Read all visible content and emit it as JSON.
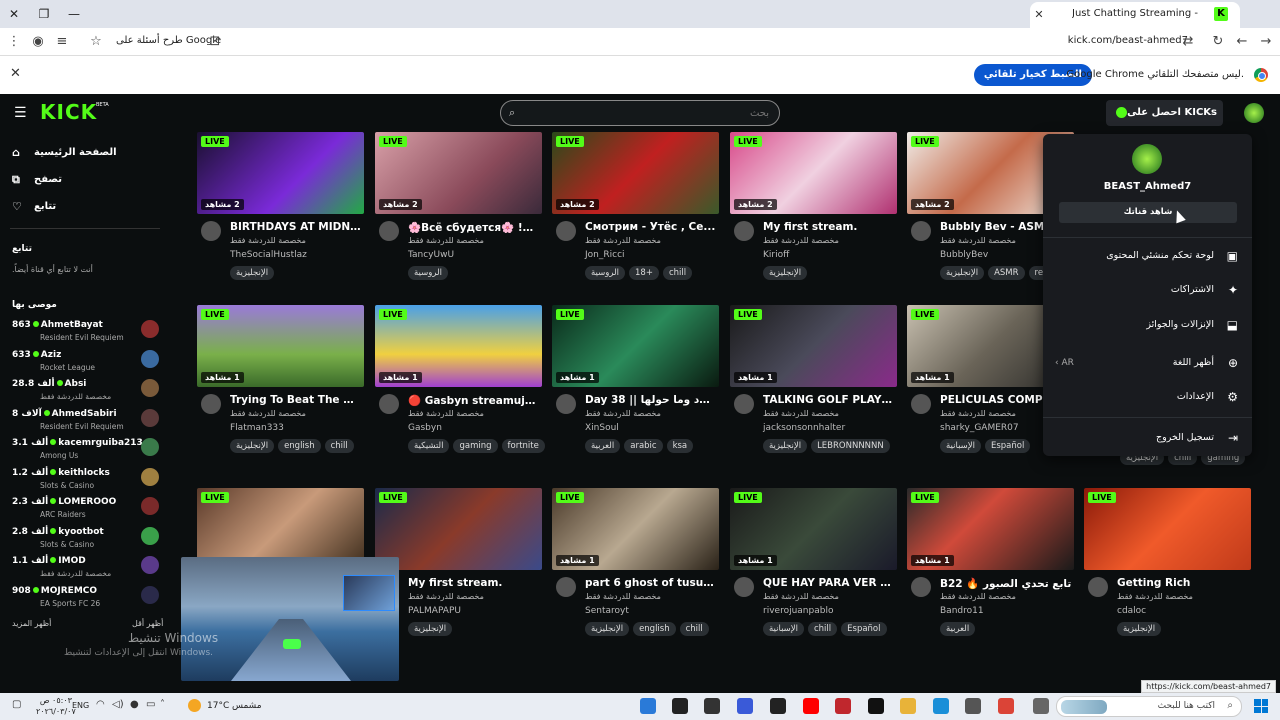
{
  "browser": {
    "tab_title": "Just Chatting Streaming - L",
    "tab_favicon": "K",
    "url": "kick.com/beast-ahmed7",
    "google_query": "طرح أسئلة على Google",
    "infobar_text": "Google Chrome ليس متصفحك التلقائي.",
    "infobar_button": "الضبط كخيار تلقائي",
    "status_url": "https://kick.com/beast-ahmed7"
  },
  "header": {
    "logo": "KICK",
    "beta": "BETA",
    "search_placeholder": "بحث",
    "get_kicks": "احصل على KICKs"
  },
  "sidebar": {
    "nav": [
      {
        "label": "الصفحة الرئيسية",
        "icon": "home-icon"
      },
      {
        "label": "تصفح",
        "icon": "browse-icon"
      },
      {
        "label": "تتابع",
        "icon": "heart-icon"
      }
    ],
    "following_heading": "تتابع",
    "following_empty": "أنت لا تتابع أي قناة أيضاً.",
    "recommended_heading": "موصى بها",
    "recommended": [
      {
        "name": "AhmetBayat",
        "viewers": "863",
        "game": "Resident Evil Requiem",
        "color": "#8a2c2c"
      },
      {
        "name": "Aziz",
        "viewers": "633",
        "game": "Rocket League",
        "color": "#3a6aa0"
      },
      {
        "name": "Absi",
        "viewers": "28.8 ألف",
        "game": "مخصصة للدردشة فقط",
        "color": "#7a5a3a"
      },
      {
        "name": "AhmedSabiri",
        "viewers": "8 آلاف",
        "game": "Resident Evil Requiem",
        "color": "#5a3a3a"
      },
      {
        "name": "kacemrguiba213",
        "viewers": "3.1 ألف",
        "game": "Among Us",
        "color": "#3a7a4a"
      },
      {
        "name": "keithlocks",
        "viewers": "1.2 ألف",
        "game": "Slots & Casino",
        "color": "#a08040"
      },
      {
        "name": "LOMEROOO",
        "viewers": "2.3 ألف",
        "game": "ARC Raiders",
        "color": "#7a2a2a"
      },
      {
        "name": "kyootbot",
        "viewers": "2.8 ألف",
        "game": "Slots & Casino",
        "color": "#3aa04a"
      },
      {
        "name": "IMOD",
        "viewers": "1.1 ألف",
        "game": "مخصصة للدردشة فقط",
        "color": "#5a3a8a"
      },
      {
        "name": "MOJREMCO",
        "viewers": "908",
        "game": "EA Sports FC 26",
        "color": "#2a2a4a"
      }
    ],
    "show_more": "أظهر المزيد",
    "show_less": "أظهر أقل"
  },
  "streams": [
    {
      "title": "BIRTHDAYS AT MIDNI...",
      "category": "مخصصة للدردشة فقط",
      "channel": "TheSocialHustlaz",
      "viewers": "2 مشاهد",
      "tags": [
        "الإنجليزية"
      ],
      "thumb": "linear-gradient(135deg,#1a1030,#7a2ad8 60%,#22aa44)"
    },
    {
      "title": "🌸Всё сбудется🌸 !b...",
      "category": "مخصصة للدردشة فقط",
      "channel": "TancyUwU",
      "viewers": "2 مشاهد",
      "tags": [
        "الروسية"
      ],
      "thumb": "linear-gradient(135deg,#d8a0a8,#8a4a5a 60%,#3a2a3a)"
    },
    {
      "title": "Смотрим - Утёс , Се...",
      "category": "مخصصة للدردشة فقط",
      "channel": "Jon_Ricci",
      "viewers": "2 مشاهد",
      "tags": [
        "الروسية",
        "18+",
        "chill"
      ],
      "thumb": "linear-gradient(135deg,#2a4a1a,#c02020 50%,#3a5a2a)"
    },
    {
      "title": "My first stream.",
      "category": "مخصصة للدردشة فقط",
      "channel": "Kirioff",
      "viewers": "2 مشاهد",
      "tags": [
        "الإنجليزية"
      ],
      "thumb": "linear-gradient(135deg,#d84a8a,#f0d0e0 50%,#b03070)"
    },
    {
      "title": "Bubbly Bev - ASMR",
      "category": "مخصصة للدردشة فقط",
      "channel": "BubblyBev",
      "viewers": "2 مشاهد",
      "tags": [
        "الإنجليزية",
        "ASMR",
        "rela"
      ],
      "thumb": "linear-gradient(135deg,#f0ece8,#c46a4a 50%,#f0e8e0)"
    },
    {
      "title": "Trying To Beat The Or...",
      "category": "مخصصة للدردشة فقط",
      "channel": "Flatman333",
      "viewers": "1 مشاهد",
      "tags": [
        "الإنجليزية",
        "english",
        "chill"
      ],
      "thumb": "linear-gradient(180deg,#9a7ad8,#7ab04a 60%,#3a6a2a)"
    },
    {
      "title": "🔴 Gasbyn streamuje ...",
      "category": "مخصصة للدردشة فقط",
      "channel": "Gasbyn",
      "viewers": "1 مشاهد",
      "tags": [
        "التشيكية",
        "gaming",
        "fortnite"
      ],
      "thumb": "linear-gradient(180deg,#4aa0e8,#f0d040 60%,#a040d0)"
    },
    {
      "title": "Day 38 || البلاد وما حولها ...",
      "category": "مخصصة للدردشة فقط",
      "channel": "XinSoul",
      "viewers": "1 مشاهد",
      "tags": [
        "العربية",
        "arabic",
        "ksa"
      ],
      "thumb": "linear-gradient(135deg,#0a2a1a,#2a8a5a 50%,#0a1a10)"
    },
    {
      "title": "TALKING GOLF PLAYI...",
      "category": "مخصصة للدردشة فقط",
      "channel": "jacksonsonnhalter",
      "viewers": "1 مشاهد",
      "tags": [
        "الإنجليزية",
        "LEBRONNNNNN"
      ],
      "thumb": "linear-gradient(135deg,#1a1a1a,#4a4a5a 50%,#8a2a8a)"
    },
    {
      "title": "PELÍCULAS COMPLI...",
      "category": "مخصصة للدردشة فقط",
      "channel": "sharky_GAMER07",
      "viewers": "1 مشاهد",
      "tags": [
        "الإسبانية",
        "Español"
      ],
      "thumb": "linear-gradient(135deg,#c8c0b0,#6a6458 50%,#2a2a28)"
    },
    {
      "title": "",
      "category": "",
      "channel": "",
      "viewers": "",
      "tags": [],
      "thumb": "linear-gradient(135deg,#5a3a2a,#c89a7a 50%,#3a2a1a)"
    },
    {
      "title": "My first stream.",
      "category": "مخصصة للدردشة فقط",
      "channel": "PALMAPAPU",
      "viewers": "",
      "tags": [
        "الإنجليزية"
      ],
      "thumb": "linear-gradient(135deg,#1a2a4a,#8a3a2a 50%,#3a4a8a)"
    },
    {
      "title": "part 6 ghost of tusush...",
      "category": "مخصصة للدردشة فقط",
      "channel": "Sentaroyt",
      "viewers": "1 مشاهد",
      "tags": [
        "الإنجليزية",
        "english",
        "chill"
      ],
      "thumb": "linear-gradient(135deg,#4a3a2a,#b8a890 50%,#2a2218)"
    },
    {
      "title": "QUE HAY PARA VER E...",
      "category": "مخصصة للدردشة فقط",
      "channel": "riverojuanpablo",
      "viewers": "1 مشاهد",
      "tags": [
        "الإسبانية",
        "chill",
        "Español"
      ],
      "thumb": "linear-gradient(135deg,#1a1a1a,#3a4a3a 50%,#1a1a2a)"
    },
    {
      "title": "B22 🔥 تابع تحدي الصبور",
      "category": "مخصصة للدردشة فقط",
      "channel": "Bandro11",
      "viewers": "1 مشاهد",
      "tags": [
        "العربية"
      ],
      "thumb": "linear-gradient(135deg,#2a2a2a,#d04a3a 40%,#1a1a1a)"
    },
    {
      "title": "Getting Rich",
      "category": "مخصصة للدردشة فقط",
      "channel": "cdaloc",
      "viewers": "",
      "tags": [
        "الإنجليزية"
      ],
      "thumb": "linear-gradient(135deg,#8a1a0a,#f05a2a 50%,#c03a1a)"
    }
  ],
  "overlap_tags": [
    "الإنجليزية",
    "chill",
    "gaming"
  ],
  "profile_menu": {
    "username": "BEAST_Ahmed7",
    "channel_button": "شاهد قناتك",
    "items": [
      {
        "label": "لوحة تحكم منشئي المحتوى",
        "icon": "dashboard-icon"
      },
      {
        "label": "الاشتراكات",
        "icon": "sparkle-icon"
      },
      {
        "label": "الإنزالات والجوائز",
        "icon": "drops-icon"
      },
      {
        "label": "أظهر اللغة",
        "icon": "globe-icon",
        "extra": "AR"
      },
      {
        "label": "الإعدادات",
        "icon": "gear-icon"
      },
      {
        "label": "تسجيل الخروج",
        "icon": "logout-icon"
      }
    ]
  },
  "watermark": {
    "line1": "تنشيط Windows",
    "line2": "انتقل إلى الإعدادات لتنشيط Windows."
  },
  "taskbar": {
    "search_text": "اكتب هنا للبحث",
    "temperature": "17°C",
    "weather": "مشمس",
    "lang": "ENG",
    "time": "٠٥:٠٣ ص",
    "date": "٢٠٢٦/٠٣/٠٧"
  }
}
